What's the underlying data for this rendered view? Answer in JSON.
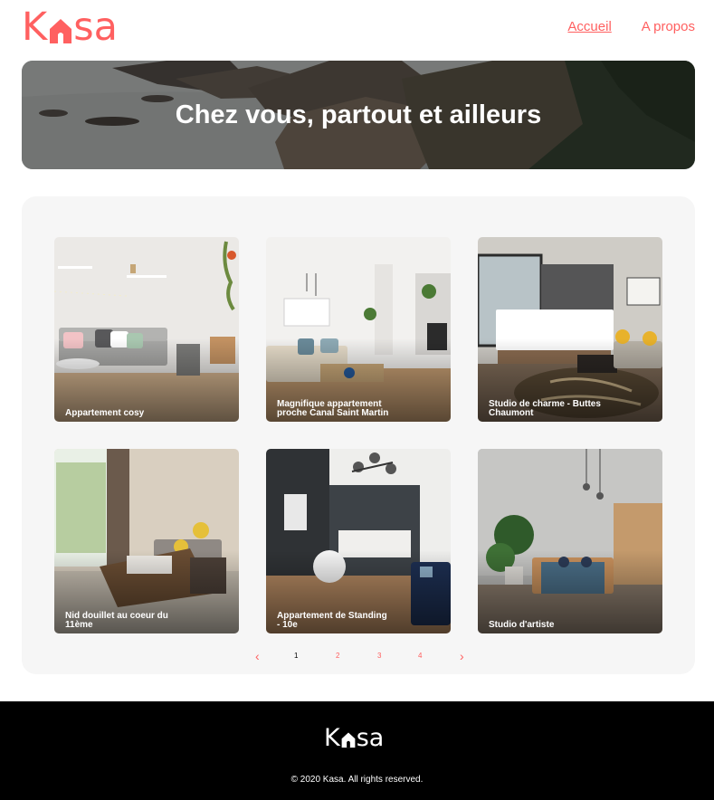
{
  "brand": {
    "logo_left": "K",
    "logo_right": "sa",
    "color": "#FF6060"
  },
  "nav": {
    "home": "Accueil",
    "about": "A propos"
  },
  "banner": {
    "title": "Chez vous, partout et ailleurs"
  },
  "listings": [
    {
      "title": "Appartement cosy"
    },
    {
      "title": "Magnifique appartement proche Canal Saint Martin"
    },
    {
      "title": "Studio de charme - Buttes Chaumont"
    },
    {
      "title": "Nid douillet au coeur du 11ème"
    },
    {
      "title": "Appartement de Standing - 10e"
    },
    {
      "title": "Studio d'artiste"
    }
  ],
  "pagination": {
    "prev_icon": "chevron-left-icon",
    "next_icon": "chevron-right-icon",
    "pages": [
      "1",
      "2",
      "3",
      "4"
    ],
    "current": "1"
  },
  "footer": {
    "logo_left": "K",
    "logo_right": "sa",
    "copyright": "© 2020 Kasa. All rights reserved."
  }
}
